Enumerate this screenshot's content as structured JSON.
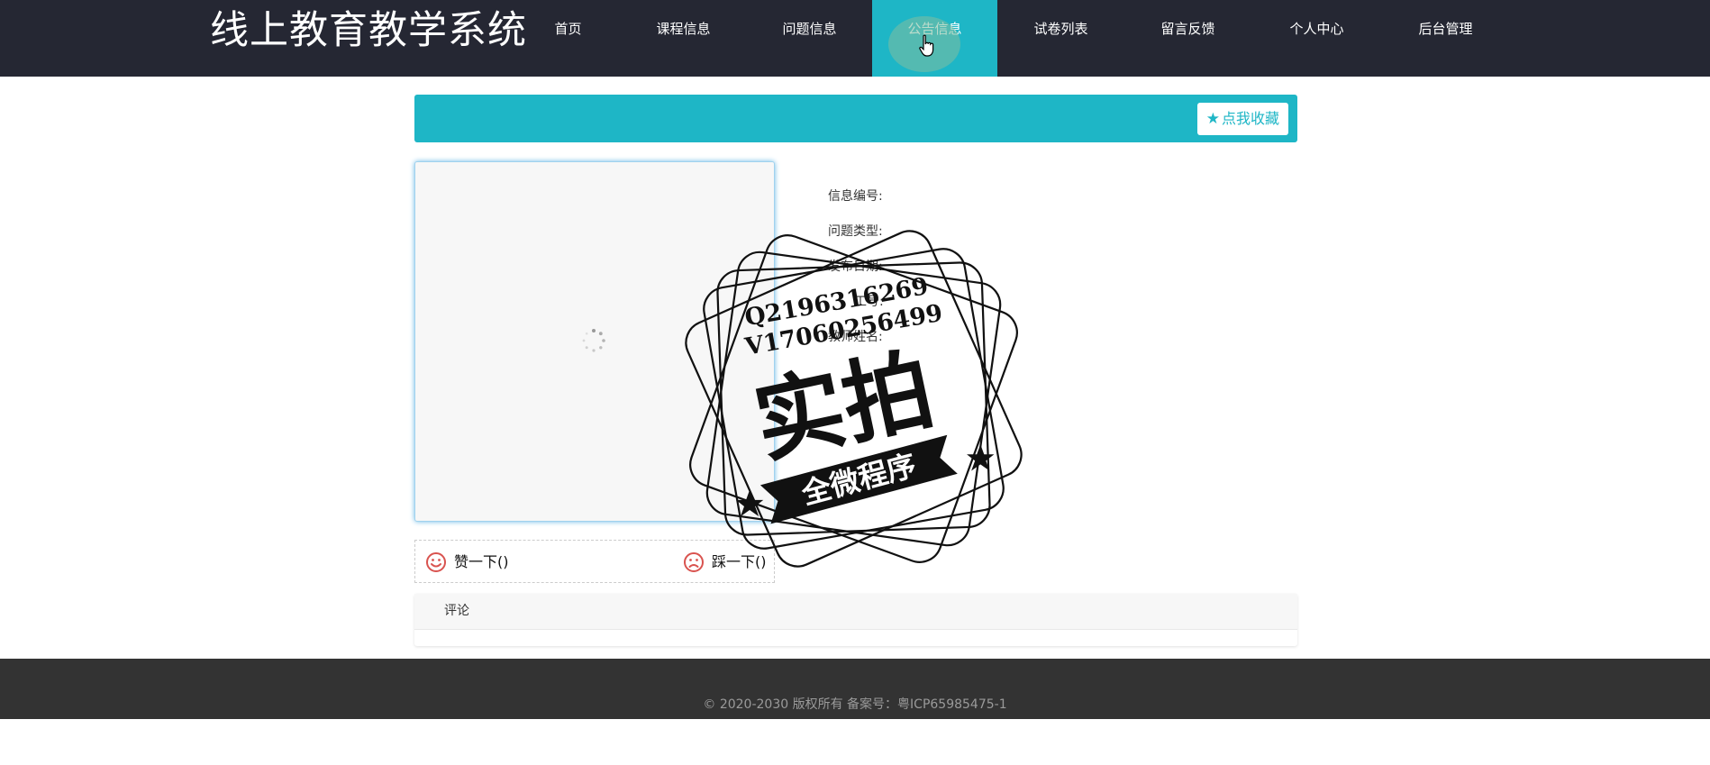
{
  "site": {
    "title": "线上教育教学系统"
  },
  "nav": {
    "items": [
      {
        "label": "首页"
      },
      {
        "label": "课程信息"
      },
      {
        "label": "问题信息"
      },
      {
        "label": "公告信息"
      },
      {
        "label": "试卷列表"
      },
      {
        "label": "留言反馈"
      },
      {
        "label": "个人中心"
      },
      {
        "label": "后台管理"
      }
    ],
    "active_index": 3
  },
  "banner": {
    "favorite_label": "点我收藏",
    "favorite_icon": "star-icon"
  },
  "info": {
    "fields": [
      {
        "label": "信息编号:"
      },
      {
        "label": "问题类型:"
      },
      {
        "label": "发布日期:"
      },
      {
        "label": "工号:"
      },
      {
        "label": "教师姓名:"
      }
    ]
  },
  "votes": {
    "like_label": "赞一下()",
    "like_icon": "smile-icon",
    "dislike_label": "踩一下()",
    "dislike_icon": "frown-icon"
  },
  "comments": {
    "title": "评论"
  },
  "footer": {
    "copyright": "© 2020-2030 版权所有 备案号：粤ICP65985475-1"
  },
  "watermark": {
    "line1": "Q2196316269",
    "line2": "V17060256499",
    "big_text": "实拍",
    "ribbon_text": "全微程序"
  },
  "colors": {
    "nav_bg": "#252733",
    "accent": "#1eb6c6",
    "footer_bg": "#333333",
    "icon_red": "#d9534f"
  }
}
